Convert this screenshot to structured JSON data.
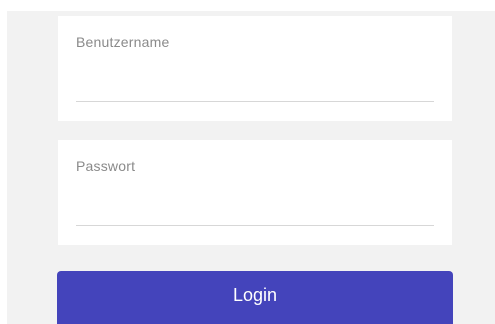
{
  "form": {
    "username": {
      "label": "Benutzername",
      "value": ""
    },
    "password": {
      "label": "Passwort",
      "value": ""
    },
    "login_label": "Login"
  },
  "colors": {
    "panel_background": "#f2f2f2",
    "card_background": "#ffffff",
    "button_background": "#4444bb",
    "button_text": "#ffffff",
    "label_text": "#8a8a8a",
    "underline": "#d7d7d7"
  }
}
